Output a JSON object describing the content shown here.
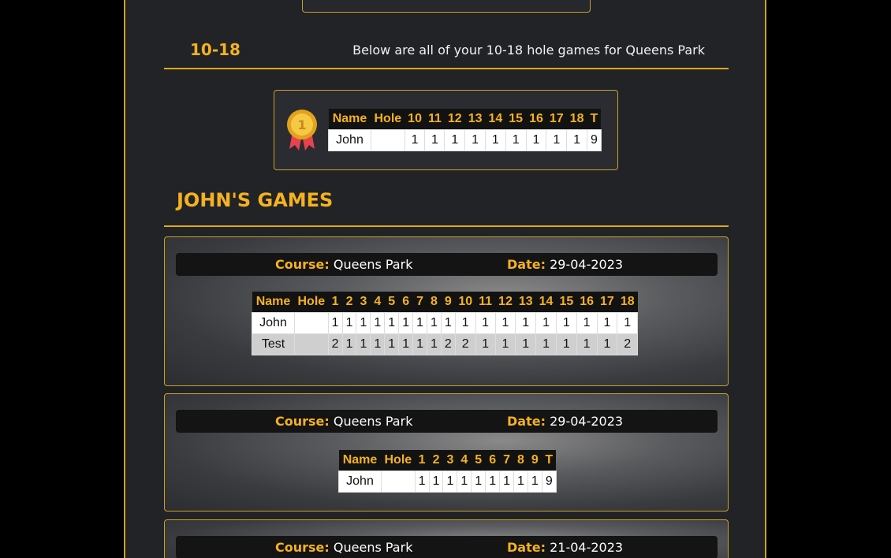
{
  "range_section": {
    "label": "10-18",
    "description": "Below are all of your 10-18 hole games for Queens Park"
  },
  "winner_table": {
    "medal_text": "1",
    "headers": [
      "Name",
      "Hole",
      "10",
      "11",
      "12",
      "13",
      "14",
      "15",
      "16",
      "17",
      "18",
      "T"
    ],
    "rows": [
      {
        "name": "John",
        "hole": "",
        "scores": [
          "1",
          "1",
          "1",
          "1",
          "1",
          "1",
          "1",
          "1",
          "1",
          "9"
        ]
      }
    ]
  },
  "games_section": {
    "title": "JOHN'S GAMES"
  },
  "games": [
    {
      "course_key": "Course:",
      "course": "Queens Park",
      "date_key": "Date:",
      "date": "29-04-2023",
      "headers": [
        "Name",
        "Hole",
        "1",
        "2",
        "3",
        "4",
        "5",
        "6",
        "7",
        "8",
        "9",
        "10",
        "11",
        "12",
        "13",
        "14",
        "15",
        "16",
        "17",
        "18"
      ],
      "rows": [
        {
          "name": "John",
          "hole": "",
          "scores": [
            "1",
            "1",
            "1",
            "1",
            "1",
            "1",
            "1",
            "1",
            "1",
            "1",
            "1",
            "1",
            "1",
            "1",
            "1",
            "1",
            "1",
            "1"
          ]
        },
        {
          "name": "Test",
          "hole": "",
          "scores": [
            "2",
            "1",
            "1",
            "1",
            "1",
            "1",
            "1",
            "1",
            "2",
            "2",
            "1",
            "1",
            "1",
            "1",
            "1",
            "1",
            "1",
            "2"
          ]
        }
      ]
    },
    {
      "course_key": "Course:",
      "course": "Queens Park",
      "date_key": "Date:",
      "date": "29-04-2023",
      "headers": [
        "Name",
        "Hole",
        "1",
        "2",
        "3",
        "4",
        "5",
        "6",
        "7",
        "8",
        "9",
        "T"
      ],
      "rows": [
        {
          "name": "John",
          "hole": "",
          "scores": [
            "1",
            "1",
            "1",
            "1",
            "1",
            "1",
            "1",
            "1",
            "1",
            "9"
          ]
        }
      ]
    },
    {
      "course_key": "Course:",
      "course": "Queens Park",
      "date_key": "Date:",
      "date": "21-04-2023"
    }
  ],
  "colors": {
    "accent": "#f5b21f",
    "border": "#c9a227",
    "panel": "#212327",
    "background": "#000000"
  }
}
